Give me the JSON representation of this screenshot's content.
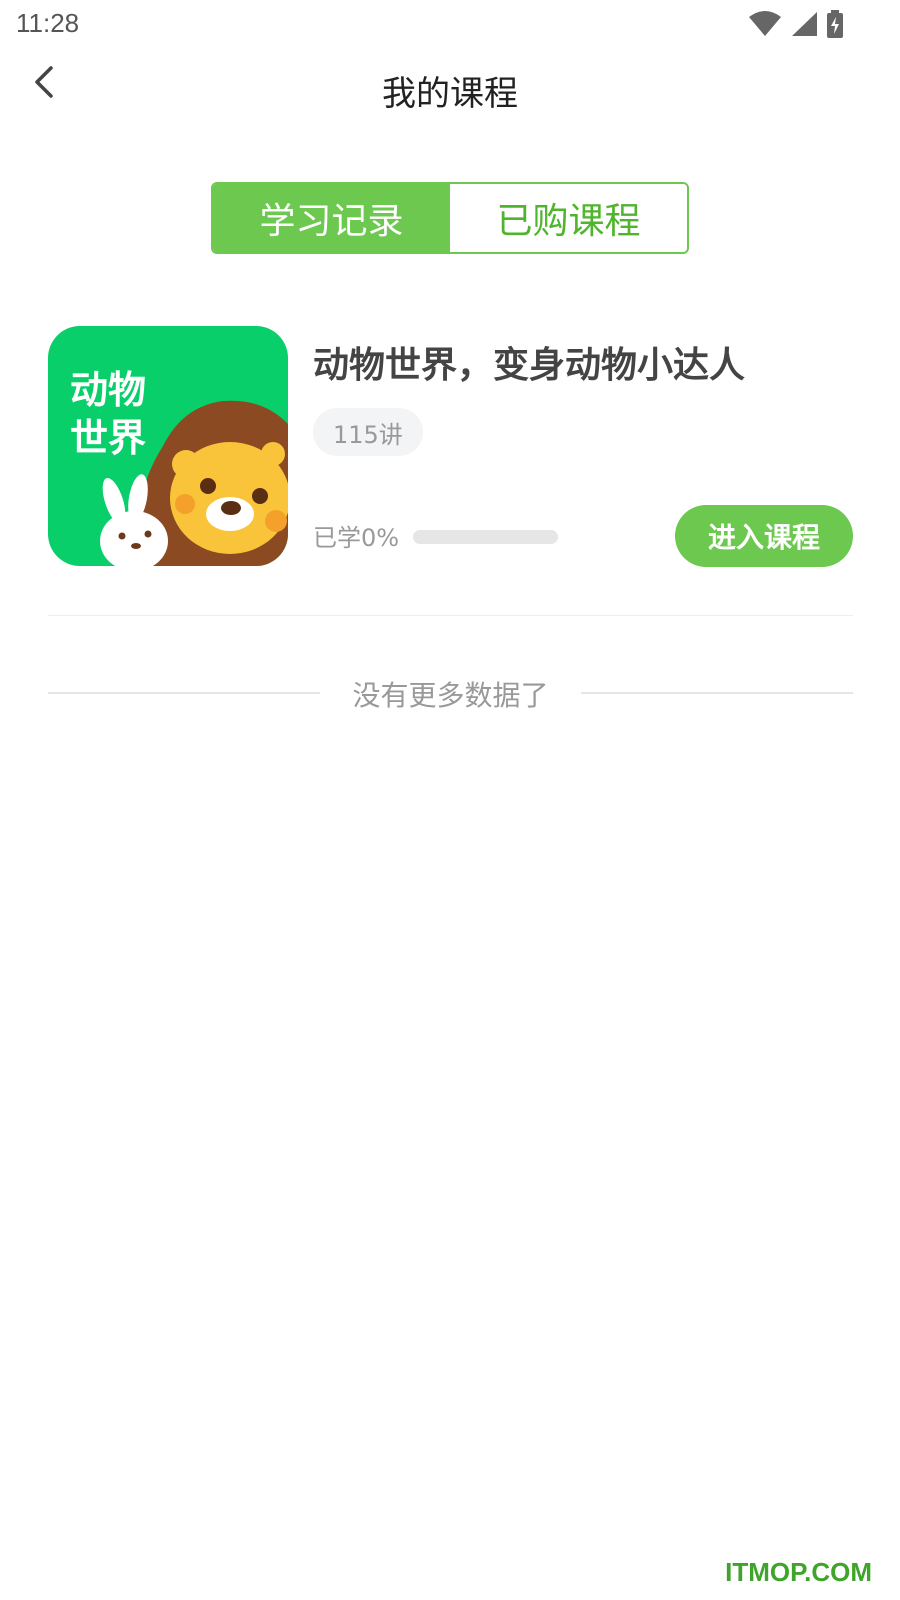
{
  "status_bar": {
    "time": "11:28",
    "icons": [
      "wifi-icon",
      "signal-icon",
      "battery-icon"
    ]
  },
  "header": {
    "title": "我的课程",
    "back_icon": "chevron-left-icon"
  },
  "tabs": [
    {
      "label": "学习记录",
      "active": true
    },
    {
      "label": "已购课程",
      "active": false
    }
  ],
  "course": {
    "cover_text_line1": "动物",
    "cover_text_line2": "世界",
    "title": "动物世界，变身动物小达人",
    "lessons": "115讲",
    "progress_text": "已学0%",
    "progress_value": 0,
    "enter_button": "进入课程"
  },
  "footer_message": "没有更多数据了",
  "watermark": "ITMOP.COM",
  "colors": {
    "accent": "#6cc84e",
    "cover_bg": "#08cf6a",
    "watermark": "#3fa52a"
  }
}
